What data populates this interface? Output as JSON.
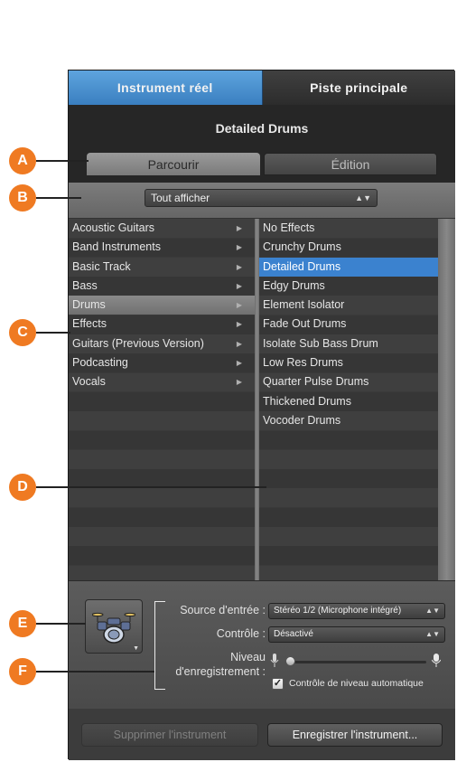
{
  "tabs": {
    "instrument": "Instrument réel",
    "track": "Piste principale"
  },
  "patch_title": "Detailed Drums",
  "subtabs": {
    "browse": "Parcourir",
    "edit": "Édition"
  },
  "filter": {
    "value": "Tout afficher"
  },
  "categories": [
    "Acoustic Guitars",
    "Band Instruments",
    "Basic Track",
    "Bass",
    "Drums",
    "Effects",
    "Guitars (Previous Version)",
    "Podcasting",
    "Vocals"
  ],
  "patches": [
    "No Effects",
    "Crunchy Drums",
    "Detailed Drums",
    "Edgy Drums",
    "Element Isolator",
    "Fade Out Drums",
    "Isolate Sub Bass Drum",
    "Low Res Drums",
    "Quarter Pulse Drums",
    "Thickened Drums",
    "Vocoder Drums"
  ],
  "selected_category": "Drums",
  "selected_patch": "Detailed Drums",
  "settings": {
    "input_label": "Source d'entrée :",
    "input_value": "Stéréo 1/2 (Microphone intégré)",
    "monitor_label": "Contrôle :",
    "monitor_value": "Désactivé",
    "level_label_1": "Niveau",
    "level_label_2": "d'enregistrement :",
    "level_fraction": 0.0,
    "auto_level_label": "Contrôle de niveau automatique",
    "auto_level_checked": true
  },
  "buttons": {
    "delete": "Supprimer l'instrument",
    "save": "Enregistrer l'instrument..."
  },
  "callouts": [
    "A",
    "B",
    "C",
    "D",
    "E",
    "F"
  ],
  "colors": {
    "accent": "#3b82cf",
    "callout": "#ef7a22"
  },
  "icons": {
    "instrument": "drum-kit-icon",
    "mic": "microphone-icon",
    "arrow": "disclosure-triangle-icon"
  }
}
